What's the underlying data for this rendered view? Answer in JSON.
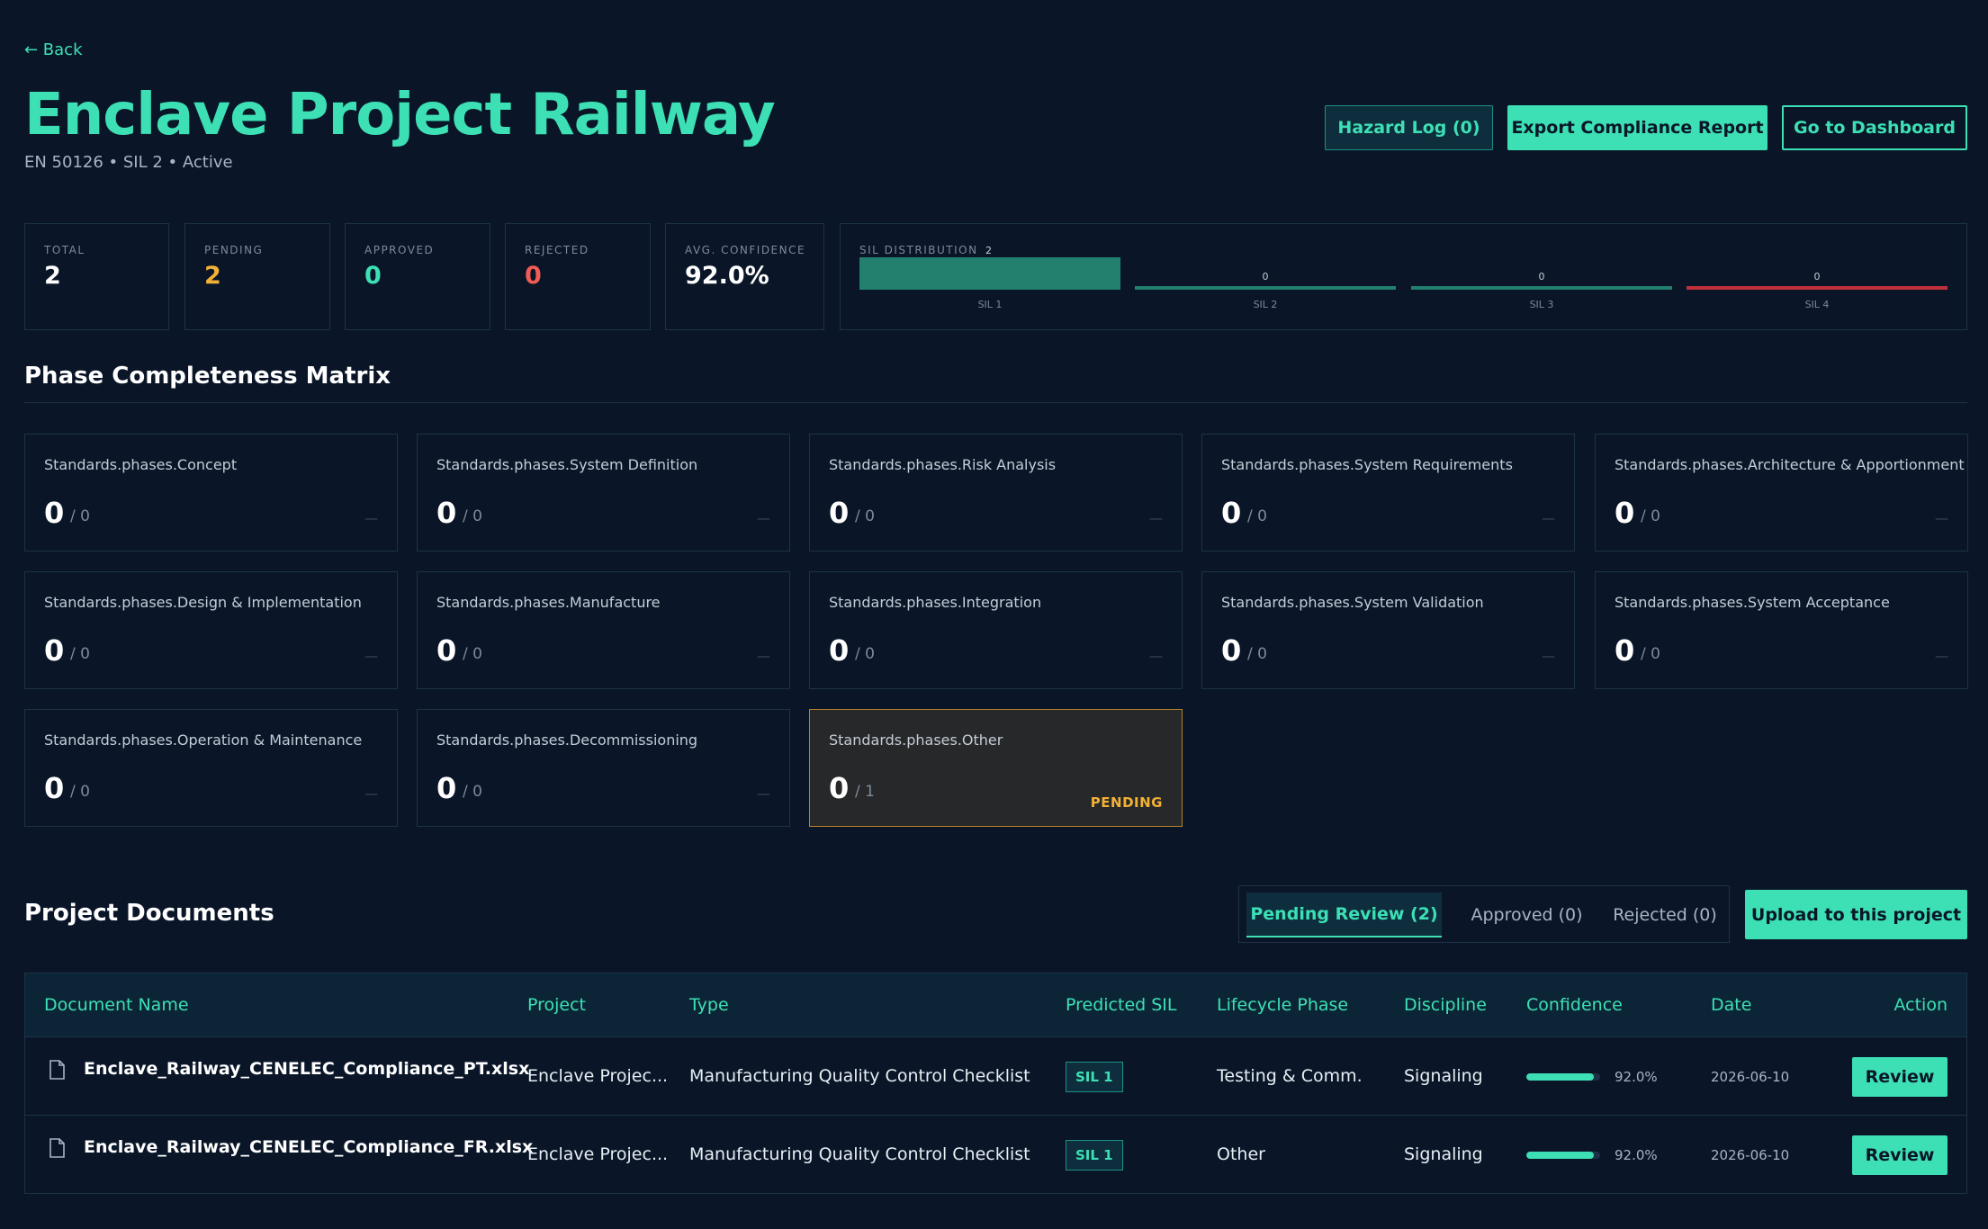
{
  "header": {
    "back_label": "← Back",
    "title": "Enclave Project Railway",
    "subtitle": "EN 50126 • SIL 2 • Active",
    "hazard_log_label": "Hazard Log (0)",
    "export_label": "Export Compliance Report",
    "dashboard_label": "Go to Dashboard"
  },
  "stats": [
    {
      "label": "TOTAL",
      "value": "2",
      "color": "#ffffff"
    },
    {
      "label": "PENDING",
      "value": "2",
      "color": "#f2b135"
    },
    {
      "label": "APPROVED",
      "value": "0",
      "color": "#3ce0b4"
    },
    {
      "label": "REJECTED",
      "value": "0",
      "color": "#f25c54"
    },
    {
      "label": "AVG. CONFIDENCE",
      "value": "92.0%",
      "color": "#ffffff"
    }
  ],
  "sil_distribution": {
    "title": "SIL DISTRIBUTION",
    "bars": [
      {
        "label": "SIL 1",
        "count": 2,
        "color": "#23806f"
      },
      {
        "label": "SIL 2",
        "count": 0,
        "color": "#23806f"
      },
      {
        "label": "SIL 3",
        "count": 0,
        "color": "#23806f"
      },
      {
        "label": "SIL 4",
        "count": 0,
        "color": "#c0303a"
      }
    ]
  },
  "phase_section": {
    "title": "Phase Completeness Matrix",
    "phases": [
      {
        "name": "Standards.phases.Concept",
        "count": "0",
        "total": "/ 0",
        "status": "—"
      },
      {
        "name": "Standards.phases.System Definition",
        "count": "0",
        "total": "/ 0",
        "status": "—"
      },
      {
        "name": "Standards.phases.Risk Analysis",
        "count": "0",
        "total": "/ 0",
        "status": "—"
      },
      {
        "name": "Standards.phases.System Requirements",
        "count": "0",
        "total": "/ 0",
        "status": "—"
      },
      {
        "name": "Standards.phases.Architecture & Apportionment",
        "count": "0",
        "total": "/ 0",
        "status": "—"
      },
      {
        "name": "Standards.phases.Design & Implementation",
        "count": "0",
        "total": "/ 0",
        "status": "—"
      },
      {
        "name": "Standards.phases.Manufacture",
        "count": "0",
        "total": "/ 0",
        "status": "—"
      },
      {
        "name": "Standards.phases.Integration",
        "count": "0",
        "total": "/ 0",
        "status": "—"
      },
      {
        "name": "Standards.phases.System Validation",
        "count": "0",
        "total": "/ 0",
        "status": "—"
      },
      {
        "name": "Standards.phases.System Acceptance",
        "count": "0",
        "total": "/ 0",
        "status": "—"
      },
      {
        "name": "Standards.phases.Operation & Maintenance",
        "count": "0",
        "total": "/ 0",
        "status": "—"
      },
      {
        "name": "Standards.phases.Decommissioning",
        "count": "0",
        "total": "/ 0",
        "status": "—"
      },
      {
        "name": "Standards.phases.Other",
        "count": "0",
        "total": "/ 1",
        "status": "PENDING"
      }
    ]
  },
  "documents": {
    "title": "Project Documents",
    "tabs": [
      {
        "label": "Pending Review (2)",
        "active": true
      },
      {
        "label": "Approved (0)",
        "active": false
      },
      {
        "label": "Rejected (0)",
        "active": false
      }
    ],
    "upload_label": "Upload to this project",
    "columns": [
      "Document Name",
      "Project",
      "Type",
      "Predicted SIL",
      "Lifecycle Phase",
      "Discipline",
      "Confidence",
      "Date",
      "Action"
    ],
    "rows": [
      {
        "name": "Enclave_Railway_CENELEC_Compliance_PT.xlsx",
        "project": "Enclave Projec...",
        "type": "Manufacturing Quality Control Checklist",
        "sil": "SIL 1",
        "phase": "Testing & Comm.",
        "discipline": "Signaling",
        "confidence": 0.92,
        "confidence_label": "92.0%",
        "date": "2026-06-10",
        "action": "Review"
      },
      {
        "name": "Enclave_Railway_CENELEC_Compliance_FR.xlsx",
        "project": "Enclave Projec...",
        "type": "Manufacturing Quality Control Checklist",
        "sil": "SIL 1",
        "phase": "Other",
        "discipline": "Signaling",
        "confidence": 0.92,
        "confidence_label": "92.0%",
        "date": "2026-06-10",
        "action": "Review"
      }
    ]
  }
}
